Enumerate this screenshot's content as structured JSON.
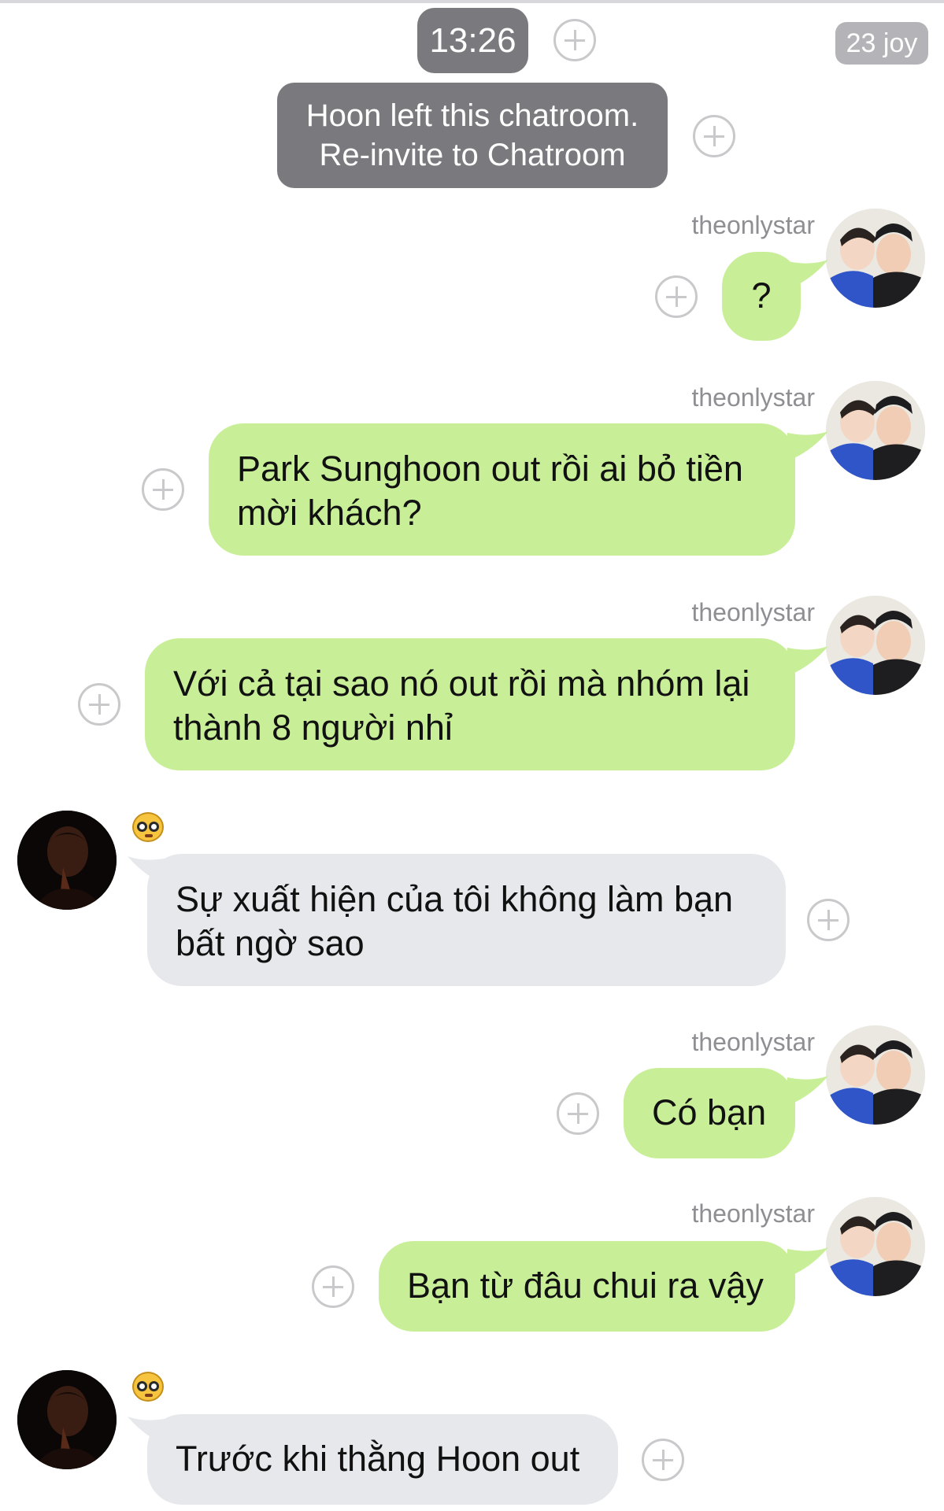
{
  "header": {
    "time": "13:26",
    "member_count": "23 joy"
  },
  "system_message": {
    "line1": "Hoon left this chatroom.",
    "line2": "Re-invite to Chatroom"
  },
  "messages": [
    {
      "sender": "theonlystar",
      "direction": "out",
      "lines": [
        "?"
      ]
    },
    {
      "sender": "theonlystar",
      "direction": "out",
      "lines": [
        "Park Sunghoon out rồi ai bỏ tiền",
        "mời khách?"
      ]
    },
    {
      "sender": "theonlystar",
      "direction": "out",
      "lines": [
        "Với cả tại sao nó out rồi mà nhóm lại",
        "thành 8 người nhỉ"
      ]
    },
    {
      "sender": "",
      "direction": "in",
      "lines": [
        "Sự xuất hiện của tôi không làm bạn",
        "bất ngờ sao"
      ]
    },
    {
      "sender": "theonlystar",
      "direction": "out",
      "lines": [
        "Có bạn"
      ]
    },
    {
      "sender": "theonlystar",
      "direction": "out",
      "lines": [
        "Bạn từ đâu chui ra vậy"
      ]
    },
    {
      "sender": "",
      "direction": "in",
      "lines": [
        "Trước khi thằng Hoon out"
      ]
    }
  ],
  "icons": {
    "add": "plus-circle-icon",
    "incoming_sender_badge": "nerd-face-emoji-icon"
  },
  "colors": {
    "outgoing_bubble": "#c8ef98",
    "incoming_bubble": "#e6e8ec",
    "system_pill": "#7a7a7e"
  }
}
